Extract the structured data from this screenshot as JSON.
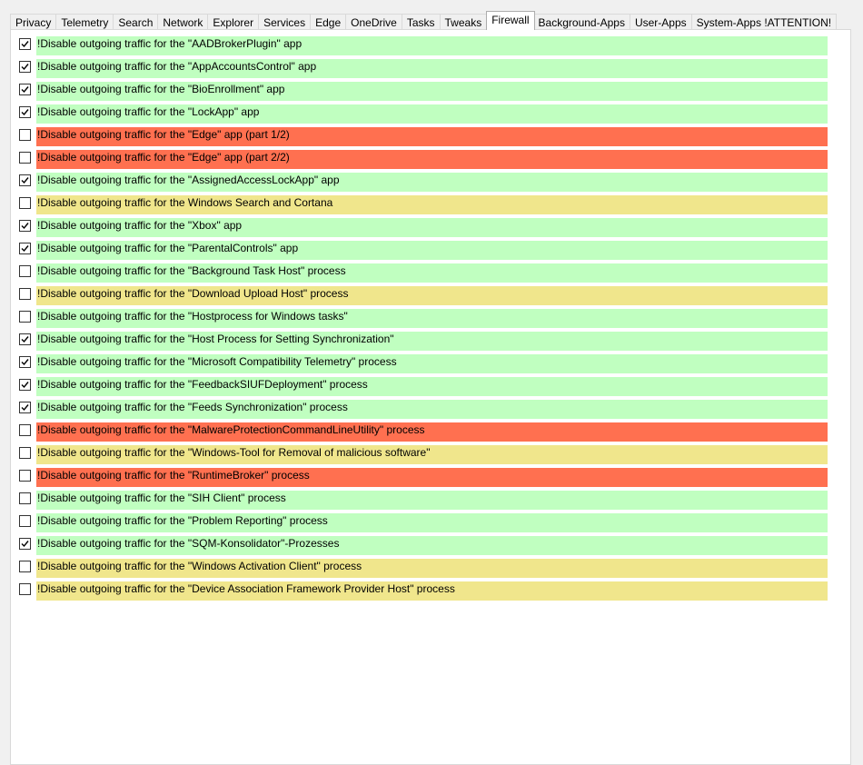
{
  "tabs": [
    {
      "label": "Privacy",
      "active": false
    },
    {
      "label": "Telemetry",
      "active": false
    },
    {
      "label": "Search",
      "active": false
    },
    {
      "label": "Network",
      "active": false
    },
    {
      "label": "Explorer",
      "active": false
    },
    {
      "label": "Services",
      "active": false
    },
    {
      "label": "Edge",
      "active": false
    },
    {
      "label": "OneDrive",
      "active": false
    },
    {
      "label": "Tasks",
      "active": false
    },
    {
      "label": "Tweaks",
      "active": false
    },
    {
      "label": "Firewall",
      "active": true
    },
    {
      "label": "Background-Apps",
      "active": false
    },
    {
      "label": "User-Apps",
      "active": false
    },
    {
      "label": "System-Apps !ATTENTION!",
      "active": false
    }
  ],
  "colors": {
    "green": "#c0ffc0",
    "red": "#ff7050",
    "yellow": "#f0e68c"
  },
  "firewall_rules": [
    {
      "label": "!Disable outgoing traffic for the \"AADBrokerPlugin\" app",
      "checked": true,
      "color": "green"
    },
    {
      "label": "!Disable outgoing traffic for the \"AppAccountsControl\" app",
      "checked": true,
      "color": "green"
    },
    {
      "label": "!Disable outgoing traffic for the \"BioEnrollment\" app",
      "checked": true,
      "color": "green"
    },
    {
      "label": "!Disable outgoing traffic for the \"LockApp\" app",
      "checked": true,
      "color": "green"
    },
    {
      "label": "!Disable outgoing traffic for the \"Edge\" app (part 1/2)",
      "checked": false,
      "color": "red"
    },
    {
      "label": "!Disable outgoing traffic for the \"Edge\" app (part 2/2)",
      "checked": false,
      "color": "red"
    },
    {
      "label": "!Disable outgoing traffic for the \"AssignedAccessLockApp\" app",
      "checked": true,
      "color": "green"
    },
    {
      "label": "!Disable outgoing traffic for the Windows Search and Cortana",
      "checked": false,
      "color": "yellow"
    },
    {
      "label": "!Disable outgoing traffic for the \"Xbox\" app",
      "checked": true,
      "color": "green"
    },
    {
      "label": "!Disable outgoing traffic for the \"ParentalControls\" app",
      "checked": true,
      "color": "green"
    },
    {
      "label": "!Disable outgoing traffic for the \"Background Task Host\" process",
      "checked": false,
      "color": "green"
    },
    {
      "label": "!Disable outgoing traffic for the \"Download Upload Host\" process",
      "checked": false,
      "color": "yellow"
    },
    {
      "label": "!Disable outgoing traffic for the \"Hostprocess for Windows tasks\"",
      "checked": false,
      "color": "green"
    },
    {
      "label": "!Disable outgoing traffic for the \"Host Process for Setting Synchronization\"",
      "checked": true,
      "color": "green"
    },
    {
      "label": "!Disable outgoing traffic for the \"Microsoft Compatibility Telemetry\" process",
      "checked": true,
      "color": "green"
    },
    {
      "label": "!Disable outgoing traffic for the \"FeedbackSIUFDeployment\" process",
      "checked": true,
      "color": "green"
    },
    {
      "label": "!Disable outgoing traffic for the \"Feeds Synchronization\" process",
      "checked": true,
      "color": "green"
    },
    {
      "label": "!Disable outgoing traffic for the \"MalwareProtectionCommandLineUtility\" process",
      "checked": false,
      "color": "red"
    },
    {
      "label": "!Disable outgoing traffic for the \"Windows-Tool for Removal of malicious software\"",
      "checked": false,
      "color": "yellow"
    },
    {
      "label": "!Disable outgoing traffic for the \"RuntimeBroker\" process",
      "checked": false,
      "color": "red"
    },
    {
      "label": "!Disable outgoing traffic for the \"SIH Client\" process",
      "checked": false,
      "color": "green"
    },
    {
      "label": "!Disable outgoing traffic for the \"Problem Reporting\" process",
      "checked": false,
      "color": "green"
    },
    {
      "label": "!Disable outgoing traffic for the \"SQM-Konsolidator\"-Prozesses",
      "checked": true,
      "color": "green"
    },
    {
      "label": "!Disable outgoing traffic for the \"Windows Activation Client\" process",
      "checked": false,
      "color": "yellow"
    },
    {
      "label": "!Disable outgoing traffic for the \"Device Association Framework Provider Host\" process",
      "checked": false,
      "color": "yellow"
    }
  ]
}
